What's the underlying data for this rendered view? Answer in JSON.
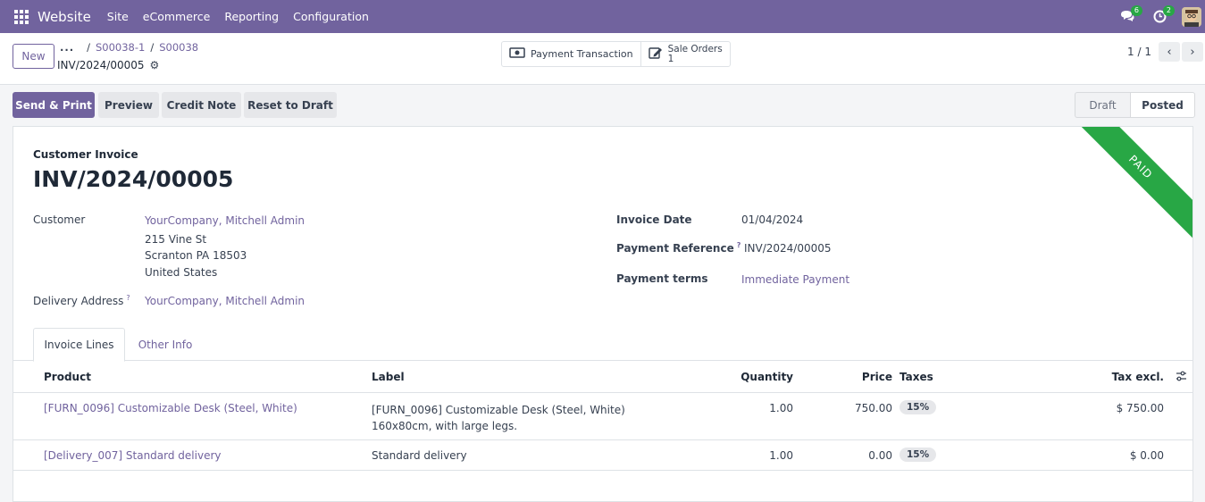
{
  "navbar": {
    "brand": "Website",
    "menu": [
      "Site",
      "eCommerce",
      "Reporting",
      "Configuration"
    ],
    "messages_count": "6",
    "activities_count": "2"
  },
  "control_panel": {
    "new_label": "New",
    "breadcrumb_dots": "...",
    "breadcrumbs": [
      "S00038-1",
      "S00038"
    ],
    "record_name": "INV/2024/00005",
    "smart_buttons": {
      "payment_transaction": "Payment Transaction",
      "sale_orders_label": "Sale Orders",
      "sale_orders_count": "1"
    },
    "pager": "1 / 1"
  },
  "actions": {
    "send_print": "Send & Print",
    "preview": "Preview",
    "credit_note": "Credit Note",
    "reset_draft": "Reset to Draft"
  },
  "statusbar": {
    "draft": "Draft",
    "posted": "Posted",
    "current": "Posted"
  },
  "form": {
    "ribbon": "PAID",
    "doc_type": "Customer Invoice",
    "doc_name": "INV/2024/00005",
    "customer_label": "Customer",
    "customer_name": "YourCompany, Mitchell Admin",
    "address": [
      "215 Vine St",
      "Scranton PA 18503",
      "United States"
    ],
    "delivery_label": "Delivery Address",
    "delivery_value": "YourCompany, Mitchell Admin",
    "invoice_date_label": "Invoice Date",
    "invoice_date": "01/04/2024",
    "payment_ref_label": "Payment Reference",
    "payment_ref": "INV/2024/00005",
    "payment_terms_label": "Payment terms",
    "payment_terms": "Immediate Payment",
    "help_mark": "?"
  },
  "tabs": [
    "Invoice Lines",
    "Other Info"
  ],
  "table": {
    "headers": {
      "product": "Product",
      "label": "Label",
      "quantity": "Quantity",
      "price": "Price",
      "taxes": "Taxes",
      "tax_excl": "Tax excl."
    },
    "rows": [
      {
        "product": "[FURN_0096] Customizable Desk (Steel, White)",
        "label_line1": "[FURN_0096] Customizable Desk (Steel, White)",
        "label_line2": "160x80cm, with large legs.",
        "quantity": "1.00",
        "price": "750.00",
        "tax": "15%",
        "subtotal": "$ 750.00"
      },
      {
        "product": "[Delivery_007] Standard delivery",
        "label_line1": "Standard delivery",
        "label_line2": "",
        "quantity": "1.00",
        "price": "0.00",
        "tax": "15%",
        "subtotal": "$ 0.00"
      }
    ]
  },
  "colors": {
    "brand": "#71639e",
    "paid_ribbon": "#28a745"
  },
  "icons": {
    "apps": "apps-grid-icon",
    "messages": "chat-icon",
    "activities": "clock-icon",
    "settings": "gear-icon",
    "payment": "money-icon",
    "sale_orders": "edit-icon",
    "optional_columns": "sliders-icon"
  }
}
